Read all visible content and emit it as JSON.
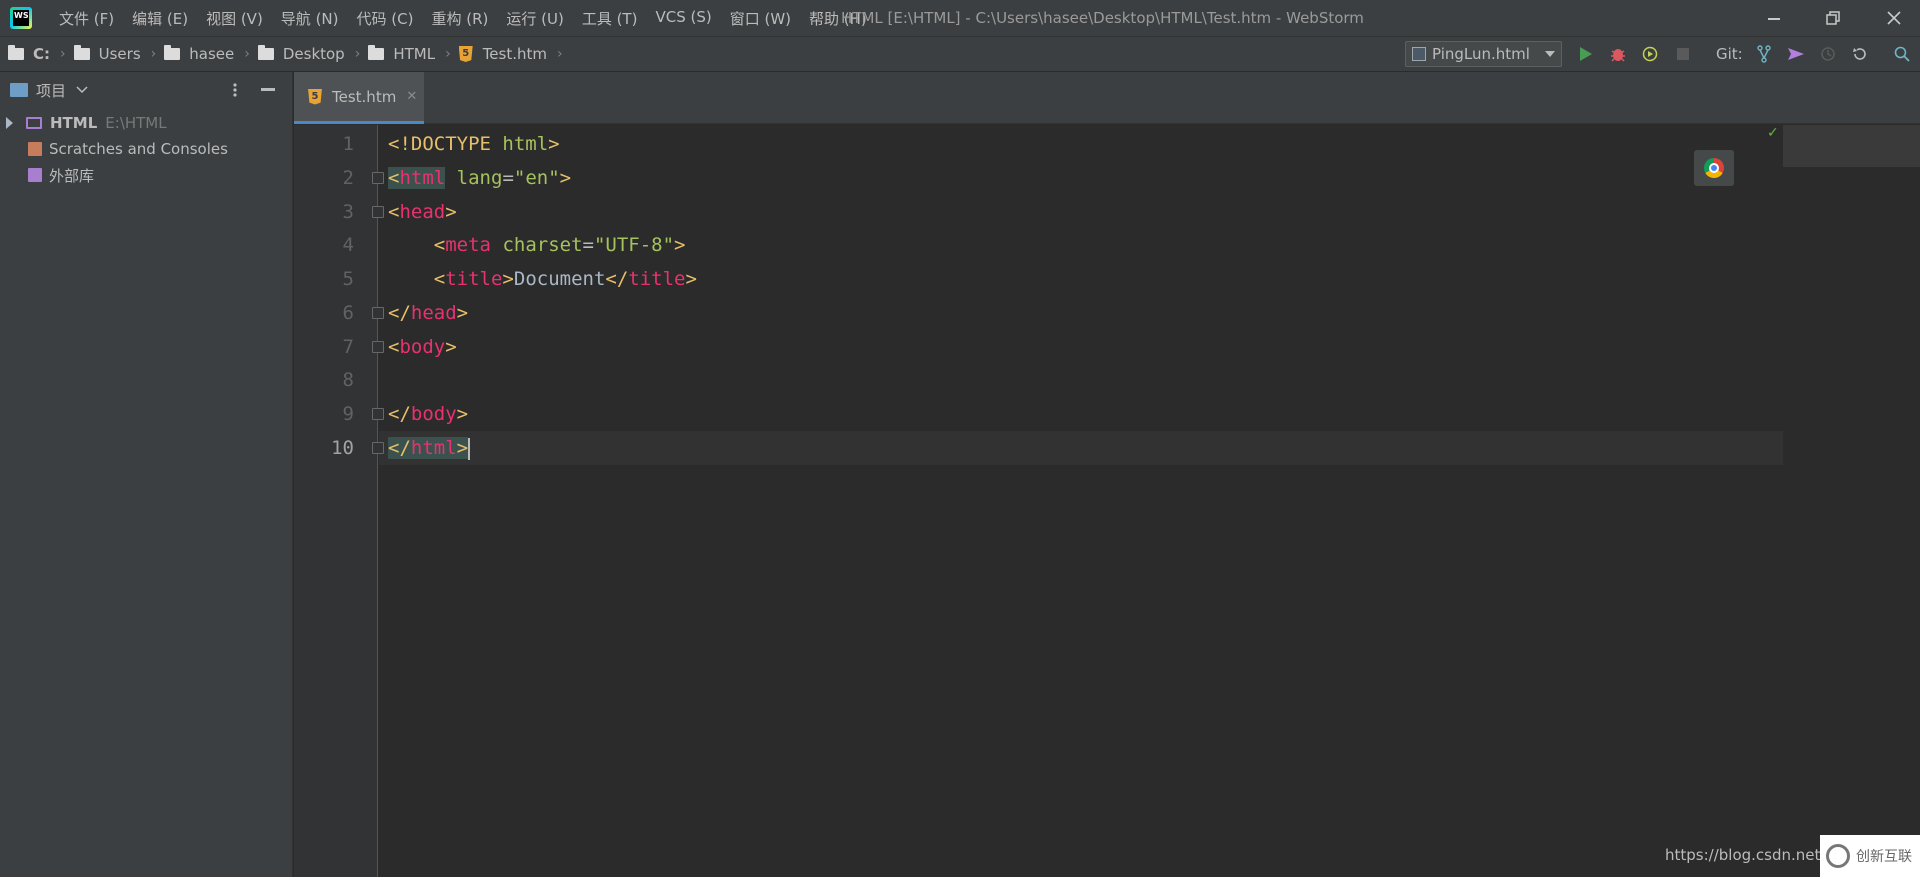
{
  "app": {
    "logo_text": "WS",
    "window_title": "HTML [E:\\HTML] - C:\\Users\\hasee\\Desktop\\HTML\\Test.htm - WebStorm"
  },
  "menu": [
    "文件 (F)",
    "编辑 (E)",
    "视图 (V)",
    "导航 (N)",
    "代码 (C)",
    "重构 (R)",
    "运行 (U)",
    "工具 (T)",
    "VCS (S)",
    "窗口 (W)",
    "帮助 (H)"
  ],
  "breadcrumbs": [
    "C:",
    "Users",
    "hasee",
    "Desktop",
    "HTML",
    "Test.htm"
  ],
  "toolbar": {
    "run_config": "PingLun.html",
    "git_label": "Git:"
  },
  "project": {
    "header": "项目",
    "tree": [
      {
        "label": "HTML",
        "path": "E:\\HTML"
      },
      {
        "label": "Scratches and Consoles"
      },
      {
        "label": "外部库"
      }
    ]
  },
  "editor": {
    "tab": "Test.htm",
    "line_numbers": [
      "1",
      "2",
      "3",
      "4",
      "5",
      "6",
      "7",
      "8",
      "9",
      "10"
    ],
    "code": [
      "<!DOCTYPE html>",
      "<html lang=\"en\">",
      "<head>",
      "    <meta charset=\"UTF-8\">",
      "    <title>Document</title>",
      "</head>",
      "<body>",
      "",
      "</body>",
      "</html>"
    ],
    "current_line": 10
  },
  "watermark": {
    "url": "https://blog.csdn.net/q",
    "logo_text": "创新互联"
  },
  "colors": {
    "background": "#2b2b2b",
    "panel": "#3c3f41",
    "tag": "#e8bf6a",
    "tag_name": "#e8326f",
    "attr_value": "#a5c25c",
    "accent": "#4a88c7"
  }
}
